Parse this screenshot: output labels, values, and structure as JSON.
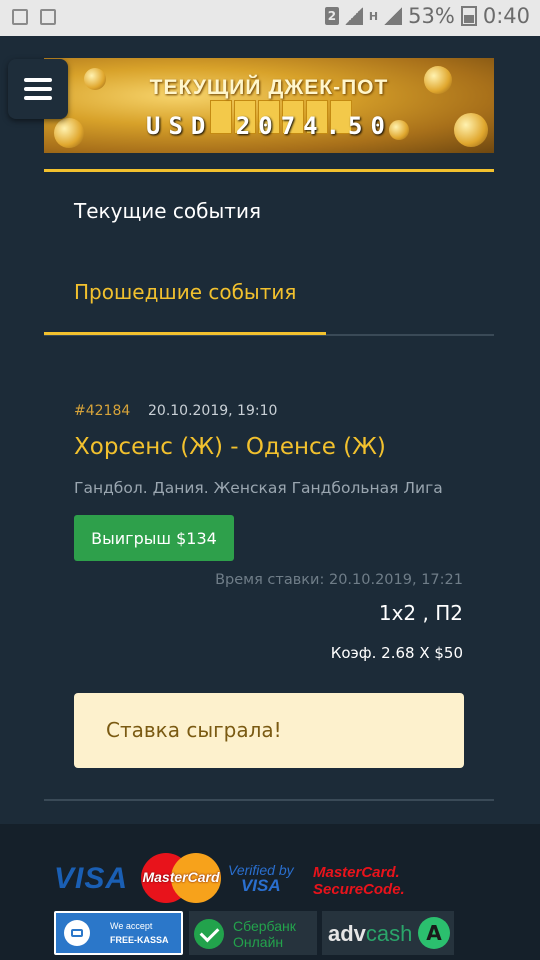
{
  "status_bar": {
    "sim": "2",
    "network": "H",
    "battery": "53%",
    "time": "0:40"
  },
  "banner": {
    "title": "ТЕКУЩИЙ ДЖЕК-ПОТ",
    "amount": "USD 2074.50"
  },
  "tabs": {
    "current": "Текущие события",
    "past": "Прошедшие события",
    "active": "past"
  },
  "event": {
    "id": "#42184",
    "date": "20.10.2019, 19:10",
    "title": "Хорсенс (Ж) - Оденсе (Ж)",
    "league": "Гандбол. Дания. Женская Гандбольная Лига",
    "win_label": "Выигрыш $134",
    "bet_time": "Время ставки: 20.10.2019, 17:21",
    "outcome": "1x2 , П2",
    "coefficient": "Коэф. 2.68 X $50",
    "result": "Ставка сыграла!"
  },
  "footer": {
    "visa": "VISA",
    "mastercard": "MasterCard",
    "verified_line1": "Verified by",
    "verified_line2": "VISA",
    "securecode_line1": "MasterCard.",
    "securecode_line2": "SecureCode.",
    "freekassa_line1": "We accept",
    "freekassa_line2": "FREE-KASSA",
    "sber_line1": "Сбербанк",
    "sber_line2": "Онлайн",
    "advcash_a": "adv",
    "advcash_b": "cash"
  },
  "colors": {
    "background": "#1c2b38",
    "accent": "#f2c12e",
    "win_green": "#2ea04b",
    "result_bg": "#fdf1cd"
  }
}
